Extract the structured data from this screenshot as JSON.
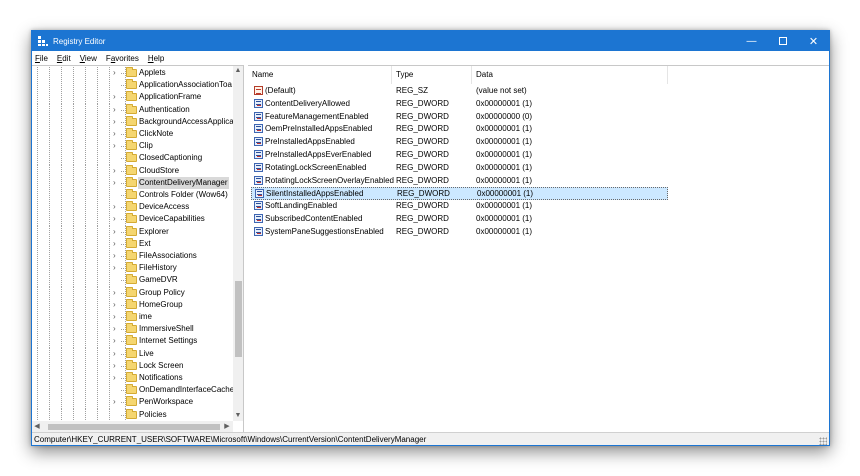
{
  "window": {
    "title": "Registry Editor",
    "accent": "#1c75d2"
  },
  "menu": [
    {
      "u": "F",
      "rest": "ile"
    },
    {
      "u": "E",
      "rest": "dit"
    },
    {
      "u": "V",
      "rest": "iew"
    },
    {
      "u": "",
      "pre": "F",
      "uu": "a",
      "rest": "vorites"
    },
    {
      "u": "H",
      "rest": "elp"
    }
  ],
  "tree": [
    {
      "label": "Applets",
      "exp": true
    },
    {
      "label": "ApplicationAssociationToa",
      "exp": false
    },
    {
      "label": "ApplicationFrame",
      "exp": true
    },
    {
      "label": "Authentication",
      "exp": true
    },
    {
      "label": "BackgroundAccessApplica",
      "exp": true
    },
    {
      "label": "ClickNote",
      "exp": true
    },
    {
      "label": "Clip",
      "exp": true
    },
    {
      "label": "ClosedCaptioning",
      "exp": false
    },
    {
      "label": "CloudStore",
      "exp": true
    },
    {
      "label": "ContentDeliveryManager",
      "exp": true,
      "selected": true
    },
    {
      "label": "Controls Folder (Wow64)",
      "exp": false
    },
    {
      "label": "DeviceAccess",
      "exp": true
    },
    {
      "label": "DeviceCapabilities",
      "exp": true
    },
    {
      "label": "Explorer",
      "exp": true
    },
    {
      "label": "Ext",
      "exp": true
    },
    {
      "label": "FileAssociations",
      "exp": true
    },
    {
      "label": "FileHistory",
      "exp": true
    },
    {
      "label": "GameDVR",
      "exp": false
    },
    {
      "label": "Group Policy",
      "exp": true
    },
    {
      "label": "HomeGroup",
      "exp": true
    },
    {
      "label": "ime",
      "exp": true
    },
    {
      "label": "ImmersiveShell",
      "exp": true
    },
    {
      "label": "Internet Settings",
      "exp": true
    },
    {
      "label": "Live",
      "exp": true
    },
    {
      "label": "Lock Screen",
      "exp": true
    },
    {
      "label": "Notifications",
      "exp": true
    },
    {
      "label": "OnDemandInterfaceCache",
      "exp": false
    },
    {
      "label": "PenWorkspace",
      "exp": true
    },
    {
      "label": "Policies",
      "exp": false
    }
  ],
  "columns": [
    "Name",
    "Type",
    "Data"
  ],
  "values": [
    {
      "name": "(Default)",
      "type": "REG_SZ",
      "data": "(value not set)",
      "icon": "sz"
    },
    {
      "name": "ContentDeliveryAllowed",
      "type": "REG_DWORD",
      "data": "0x00000001 (1)",
      "icon": "dword"
    },
    {
      "name": "FeatureManagementEnabled",
      "type": "REG_DWORD",
      "data": "0x00000000 (0)",
      "icon": "dword"
    },
    {
      "name": "OemPreInstalledAppsEnabled",
      "type": "REG_DWORD",
      "data": "0x00000001 (1)",
      "icon": "dword"
    },
    {
      "name": "PreInstalledAppsEnabled",
      "type": "REG_DWORD",
      "data": "0x00000001 (1)",
      "icon": "dword"
    },
    {
      "name": "PreInstalledAppsEverEnabled",
      "type": "REG_DWORD",
      "data": "0x00000001 (1)",
      "icon": "dword"
    },
    {
      "name": "RotatingLockScreenEnabled",
      "type": "REG_DWORD",
      "data": "0x00000001 (1)",
      "icon": "dword"
    },
    {
      "name": "RotatingLockScreenOverlayEnabled",
      "type": "REG_DWORD",
      "data": "0x00000001 (1)",
      "icon": "dword"
    },
    {
      "name": "SilentInstalledAppsEnabled",
      "type": "REG_DWORD",
      "data": "0x00000001 (1)",
      "icon": "dword",
      "selected": true
    },
    {
      "name": "SoftLandingEnabled",
      "type": "REG_DWORD",
      "data": "0x00000001 (1)",
      "icon": "dword"
    },
    {
      "name": "SubscribedContentEnabled",
      "type": "REG_DWORD",
      "data": "0x00000001 (1)",
      "icon": "dword"
    },
    {
      "name": "SystemPaneSuggestionsEnabled",
      "type": "REG_DWORD",
      "data": "0x00000001 (1)",
      "icon": "dword"
    }
  ],
  "status": {
    "path": "Computer\\HKEY_CURRENT_USER\\SOFTWARE\\Microsoft\\Windows\\CurrentVersion\\ContentDeliveryManager"
  }
}
